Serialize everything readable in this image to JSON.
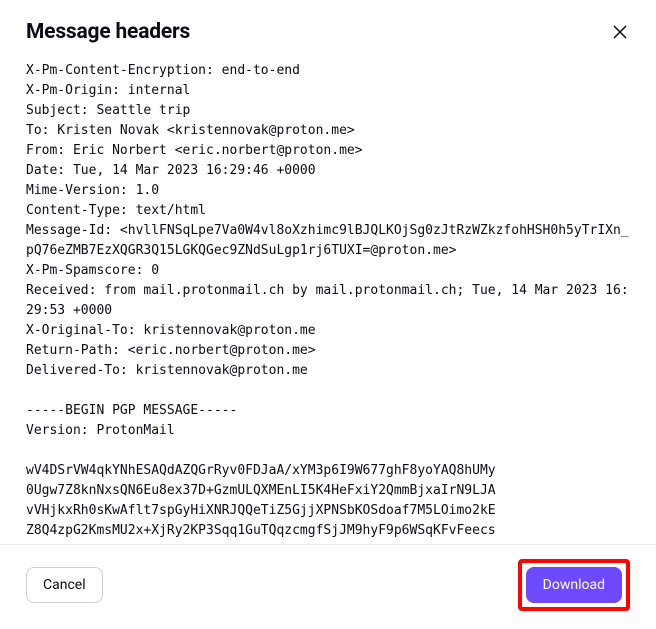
{
  "title": "Message headers",
  "headers_text": "X-Pm-Content-Encryption: end-to-end\nX-Pm-Origin: internal\nSubject: Seattle trip\nTo: Kristen Novak <kristennovak@proton.me>\nFrom: Eric Norbert <eric.norbert@proton.me>\nDate: Tue, 14 Mar 2023 16:29:46 +0000\nMime-Version: 1.0\nContent-Type: text/html\nMessage-Id: <hvllFNSqLpe7Va0W4vl8oXzhimc9lBJQLKOjSg0zJtRzWZkzfohHSH0h5yTrIXn_pQ76eZMB7EzXQGR3Q15LGKQGec9ZNdSuLgp1rj6TUXI=@proton.me>\nX-Pm-Spamscore: 0\nReceived: from mail.protonmail.ch by mail.protonmail.ch; Tue, 14 Mar 2023 16:29:53 +0000\nX-Original-To: kristennovak@proton.me\nReturn-Path: <eric.norbert@proton.me>\nDelivered-To: kristennovak@proton.me\n\n-----BEGIN PGP MESSAGE-----\nVersion: ProtonMail\n\nwV4DSrVW4qkYNhESAQdAZQGrRyv0FDJaA/xYM3p6I9W677ghF8yoYAQ8hUMy\n0Ugw7Z8knNxsQN6Eu8ex37D+GzmULQXMEnLI5K4HeFxiY2QmmBjxaIrN9LJA\nvVHjkxRh0sKwAflt7spGyHiXNRJQQeTiZ5GjjXPNSbKOSdoaf7M5LOimo2kE\nZ8Q4zpG2KmsMU2x+XjRy2KP3Sqq1GuTQqzcmgfSjJM9hyF9p6WSqKFvFeecs",
  "buttons": {
    "cancel": "Cancel",
    "download": "Download"
  }
}
